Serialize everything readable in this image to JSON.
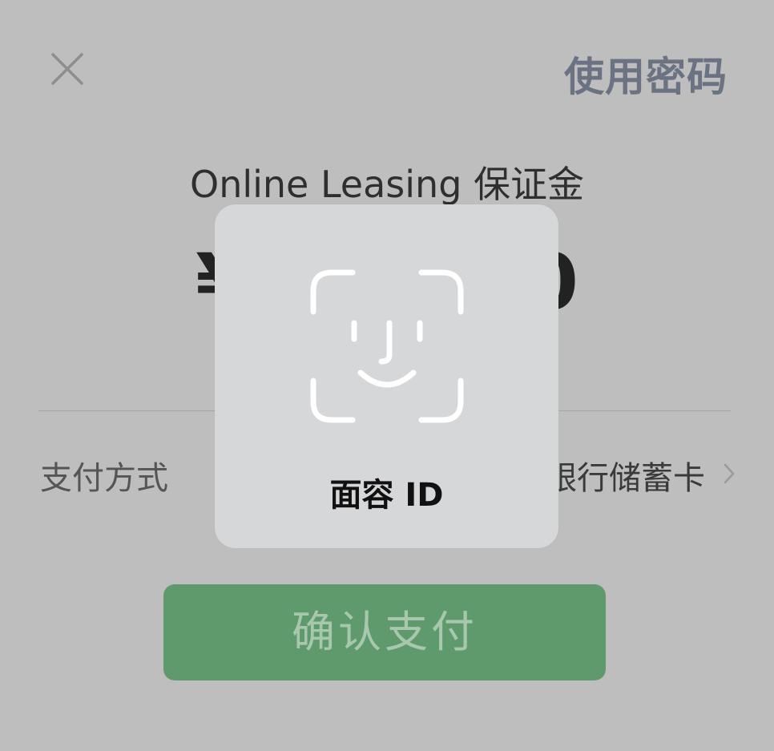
{
  "header": {
    "close_icon": "close-icon",
    "use_password_label": "使用密码"
  },
  "payment": {
    "merchant_title": "Online Leasing 保证金",
    "amount_visible": "¥",
    "amount_tail": "0"
  },
  "method": {
    "label": "支付方式",
    "value_visible": "银行储蓄卡",
    "chevron_icon": "chevron-right-icon"
  },
  "confirm": {
    "label": "确认支付"
  },
  "faceid": {
    "icon": "face-id-icon",
    "label": "面容 ID"
  },
  "colors": {
    "background": "#bebebe",
    "accent_button": "#5f9a6d",
    "link_text": "#6b7383",
    "hud_background": "#d6d7d9"
  }
}
